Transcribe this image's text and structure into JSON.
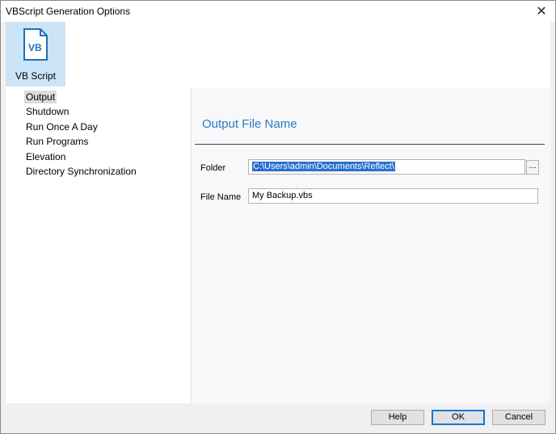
{
  "window": {
    "title": "VBScript Generation Options"
  },
  "toolbar": {
    "vb_label": "VB Script",
    "icon_text": "VB"
  },
  "nav": {
    "items": [
      {
        "label": "Output"
      },
      {
        "label": "Shutdown"
      },
      {
        "label": "Run Once A Day"
      },
      {
        "label": "Run Programs"
      },
      {
        "label": "Elevation"
      },
      {
        "label": "Directory Synchronization"
      }
    ],
    "selected": "Output"
  },
  "main": {
    "section_title": "Output File Name",
    "folder_label": "Folder",
    "folder_value": "C:\\Users\\admin\\Documents\\Reflect\\",
    "browse_label": "...",
    "filename_label": "File Name",
    "filename_value": "My Backup.vbs"
  },
  "footer": {
    "help": "Help",
    "ok": "OK",
    "cancel": "Cancel"
  },
  "colors": {
    "accent": "#2b7bc0",
    "selection": "#cce4f7"
  }
}
